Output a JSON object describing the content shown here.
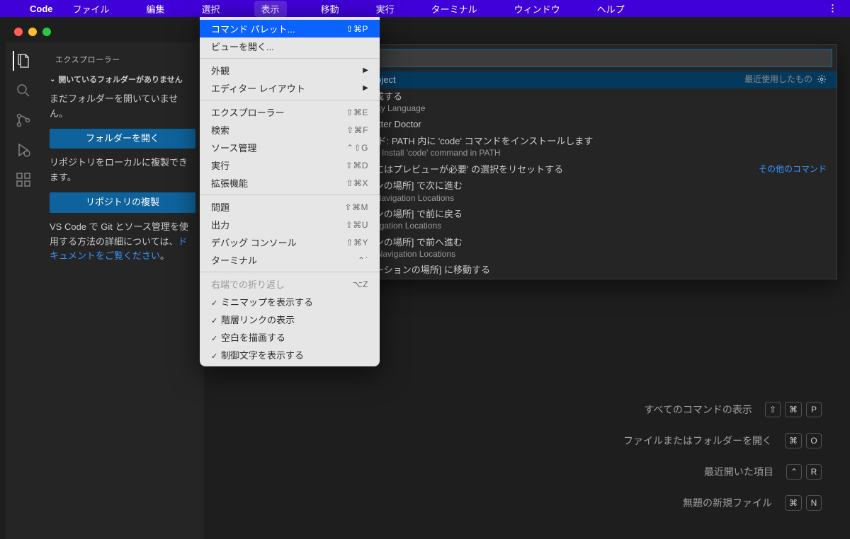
{
  "menubar": {
    "app": "Code",
    "items": [
      "ファイル",
      "編集",
      "選択",
      "表示",
      "移動",
      "実行",
      "ターミナル",
      "ウィンドウ",
      "ヘルプ"
    ],
    "active_index": 3
  },
  "sidebar": {
    "title": "エクスプローラー",
    "header": "開いているフォルダーがありません",
    "msg1": "まだフォルダーを開いていません。",
    "btn1": "フォルダーを開く",
    "msg2": "リポジトリをローカルに複製できます。",
    "btn2": "リポジトリの複製",
    "msg3a": "VS Code で Git とソース管理を使用する方法の詳細については、",
    "link": "ドキュメントをご覧ください",
    "msg3b": "。"
  },
  "dropdown": {
    "groups": [
      [
        {
          "label": "コマンド パレット...",
          "shortcut": "⇧⌘P",
          "highlighted": true
        },
        {
          "label": "ビューを開く..."
        }
      ],
      [
        {
          "label": "外観",
          "arrow": true
        },
        {
          "label": "エディター レイアウト",
          "arrow": true
        }
      ],
      [
        {
          "label": "エクスプローラー",
          "shortcut": "⇧⌘E"
        },
        {
          "label": "検索",
          "shortcut": "⇧⌘F"
        },
        {
          "label": "ソース管理",
          "shortcut": "⌃⇧G"
        },
        {
          "label": "実行",
          "shortcut": "⇧⌘D"
        },
        {
          "label": "拡張機能",
          "shortcut": "⇧⌘X"
        }
      ],
      [
        {
          "label": "問題",
          "shortcut": "⇧⌘M"
        },
        {
          "label": "出力",
          "shortcut": "⇧⌘U"
        },
        {
          "label": "デバッグ コンソール",
          "shortcut": "⇧⌘Y"
        },
        {
          "label": "ターミナル",
          "shortcut": "⌃`"
        }
      ],
      [
        {
          "label": "右端での折り返し",
          "shortcut": "⌥Z",
          "disabled": true
        },
        {
          "label": "ミニマップを表示する",
          "checked": true
        },
        {
          "label": "階層リンクの表示",
          "checked": true
        },
        {
          "label": "空白を描画する",
          "checked": true
        },
        {
          "label": "制御文字を表示する",
          "checked": true
        }
      ]
    ]
  },
  "palette": {
    "items": [
      {
        "title": "r: New Project",
        "right": "最近使用したもの",
        "gear": true,
        "selected": true
      },
      {
        "title": "言語を構成する",
        "sub": "gure Display Language"
      },
      {
        "title": "r: Run Flutter Doctor"
      },
      {
        "title": "ル コマンド: PATH 内に 'code' コマンドをインストールします",
        "sub": "Command: Install 'code' command in PATH"
      },
      {
        "title": "イル操作にはプレビューが必要' の選択をリセットする",
        "right": "その他のコマンド",
        "rightlink": true
      },
      {
        "title": "ゲーションの場所] で次に進む",
        "sub": "orward in Navigation Locations"
      },
      {
        "title": "ゲーションの場所] で前に戻る",
        "sub": "ack in Navigation Locations"
      },
      {
        "title": "ゲーションの場所] で前へ進む",
        "sub": "revious in Navigation Locations"
      },
      {
        "title": "のナビゲーションの場所] に移動する"
      }
    ]
  },
  "hints": [
    {
      "label": "すべてのコマンドの表示",
      "keys": [
        "⇧",
        "⌘",
        "P"
      ]
    },
    {
      "label": "ファイルまたはフォルダーを開く",
      "keys": [
        "⌘",
        "O"
      ]
    },
    {
      "label": "最近開いた項目",
      "keys": [
        "⌃",
        "R"
      ]
    },
    {
      "label": "無題の新規ファイル",
      "keys": [
        "⌘",
        "N"
      ]
    }
  ]
}
